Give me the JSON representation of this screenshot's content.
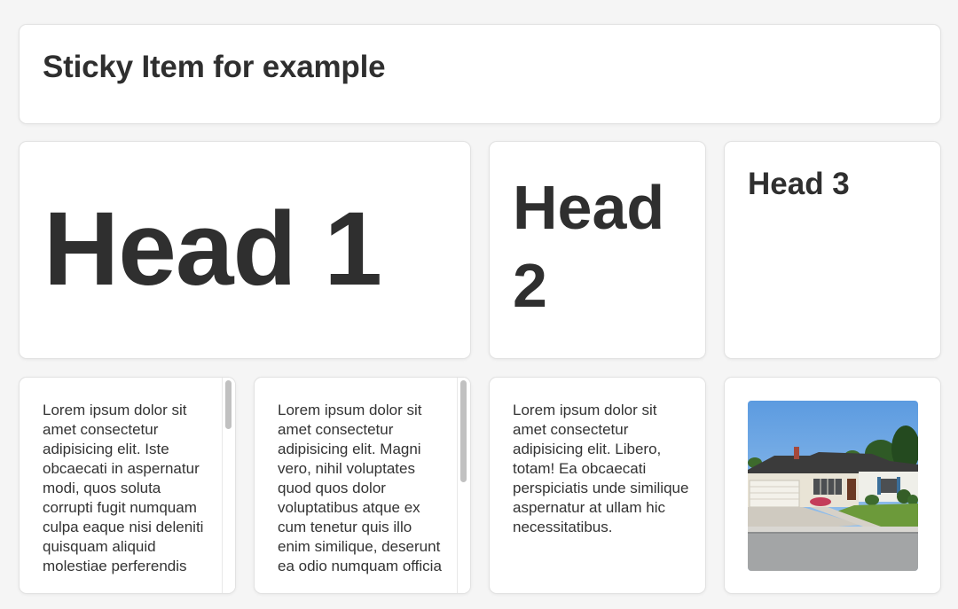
{
  "sticky": {
    "title": "Sticky Item for example"
  },
  "heads": {
    "head1": "Head 1",
    "head2": "Head 2",
    "head3": "Head 3"
  },
  "cards": [
    {
      "text": "Lorem ipsum dolor sit amet consectetur adipisicing elit. Iste obcaecati in aspernatur modi, quos soluta corrupti fugit numquam culpa eaque nisi deleniti quisquam aliquid molestiae perferendis"
    },
    {
      "text": "Lorem ipsum dolor sit amet consectetur adipisicing elit. Magni vero, nihil voluptates quod quos dolor voluptatibus atque ex cum tenetur quis illo enim similique, deserunt ea odio numquam officia"
    },
    {
      "text": "Lorem ipsum dolor sit amet consectetur adipisicing elit. Libero, totam! Ea obcaecati perspiciatis unde similique aspernatur at ullam hic necessitatibus."
    }
  ],
  "image": {
    "icon": "house-photo"
  },
  "colors": {
    "page_bg": "#f5f5f5",
    "card_bg": "#ffffff",
    "text": "#333333",
    "scroll_thumb": "#c1c1c1"
  }
}
